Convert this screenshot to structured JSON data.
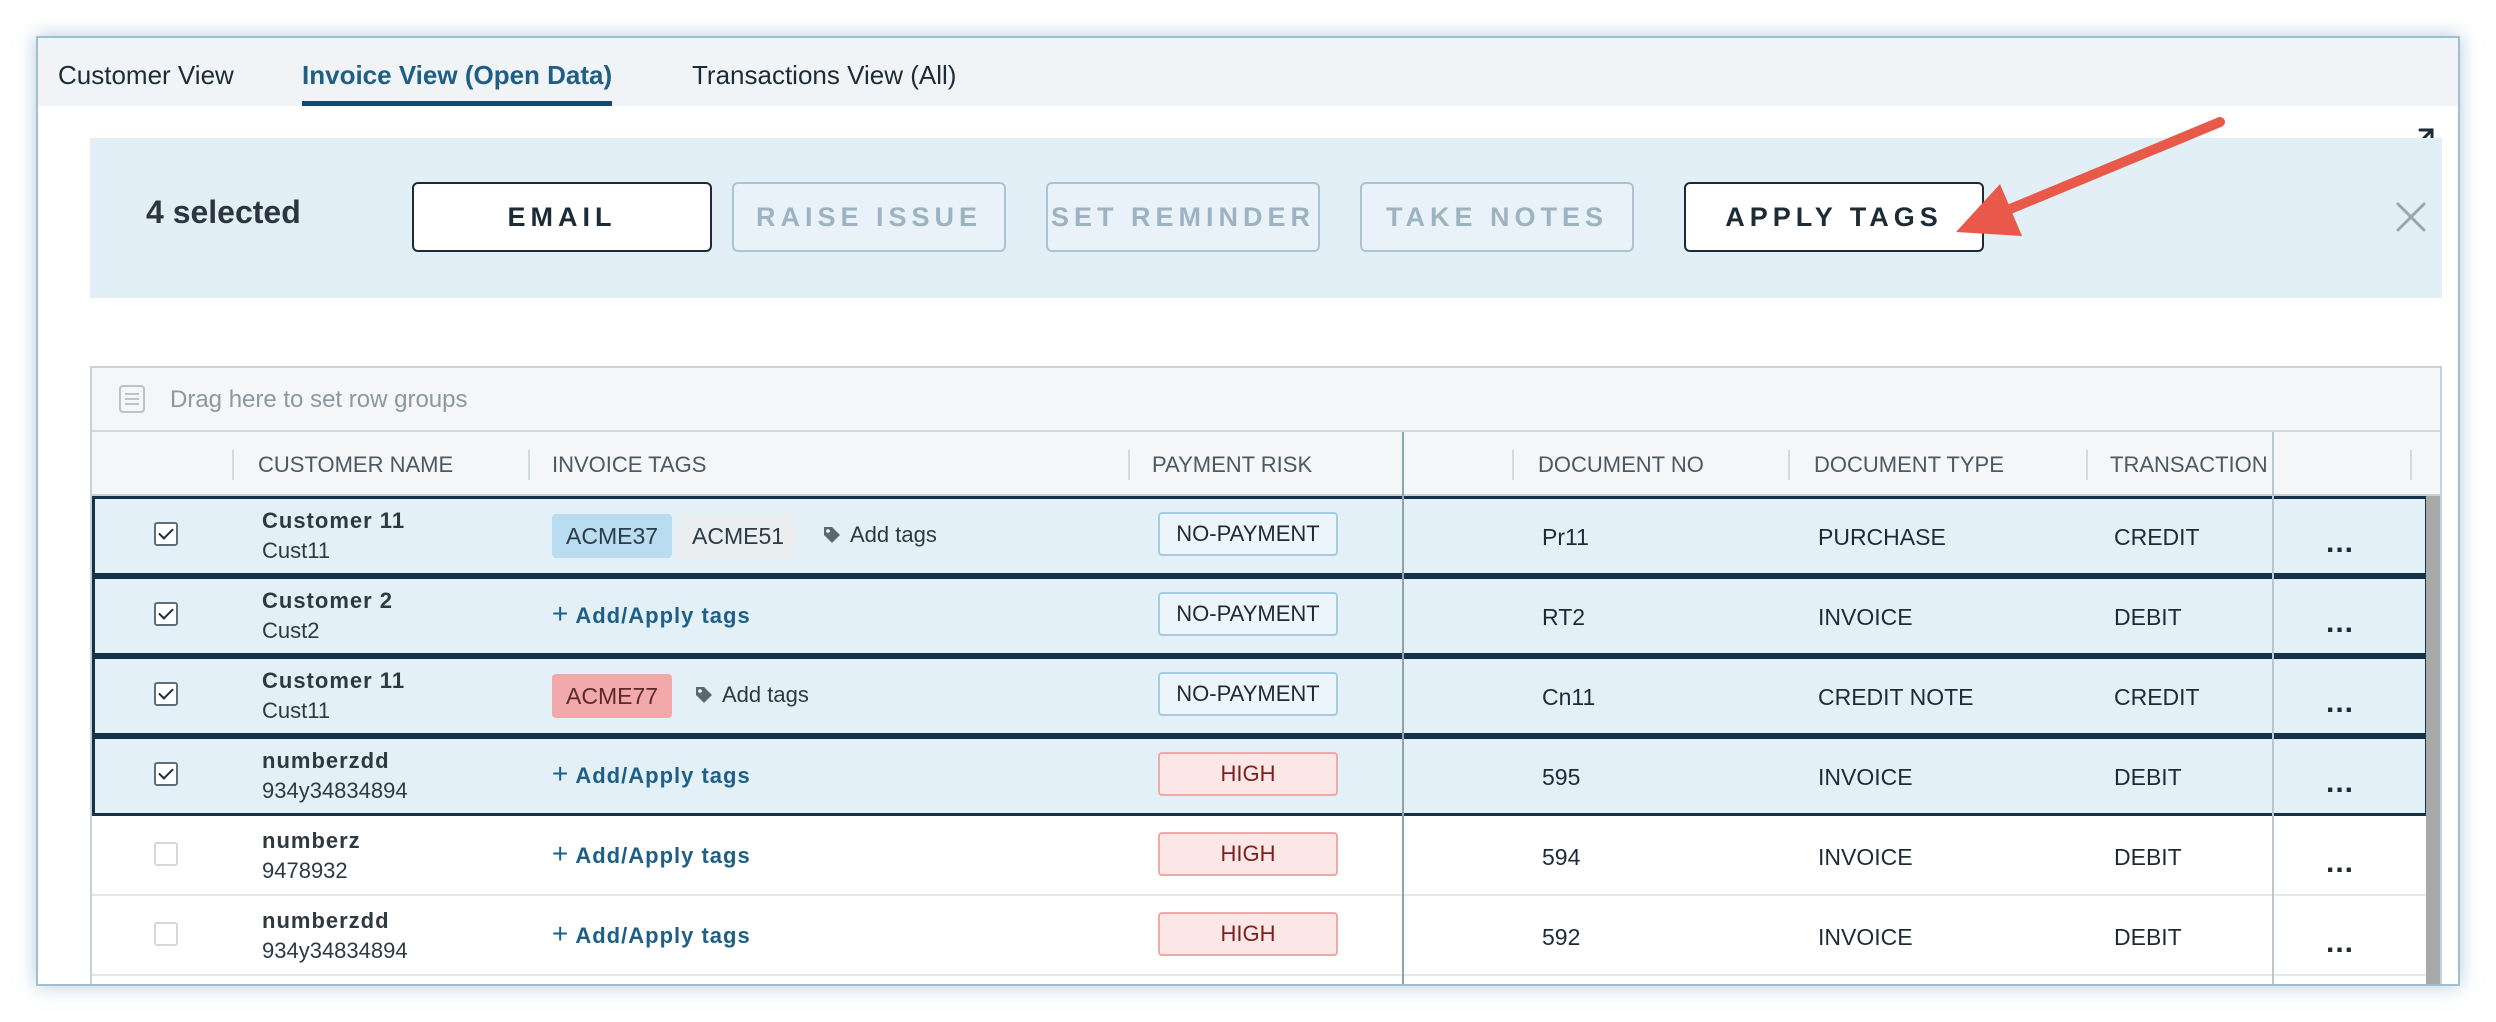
{
  "tabs": [
    "Customer View",
    "Invoice View (Open Data)",
    "Transactions View (All)"
  ],
  "selection": {
    "count_label": "4 selected",
    "buttons": {
      "email": "EMAIL",
      "raise_issue": "RAISE ISSUE",
      "set_reminder": "SET REMINDER",
      "take_notes": "TAKE NOTES",
      "apply_tags": "APPLY TAGS"
    }
  },
  "grid": {
    "group_placeholder": "Drag here to set row groups",
    "columns": {
      "customer_name": "CUSTOMER NAME",
      "invoice_tags": "INVOICE TAGS",
      "payment_risk": "PAYMENT RISK",
      "document_no": "DOCUMENT NO",
      "document_type": "DOCUMENT TYPE",
      "transaction": "TRANSACTION"
    },
    "add_tags_label": "Add tags",
    "add_apply_label": "Add/Apply tags",
    "more_label": "...",
    "rows": [
      {
        "name": "Customer 11",
        "id": "Cust11",
        "tags": [
          "ACME37",
          "ACME51"
        ],
        "risk": "NO-PAYMENT",
        "doc_no": "Pr11",
        "doc_type": "PURCHASE",
        "transaction": "CREDIT",
        "selected": true
      },
      {
        "name": "Customer 2",
        "id": "Cust2",
        "tags": [],
        "risk": "NO-PAYMENT",
        "doc_no": "RT2",
        "doc_type": "INVOICE",
        "transaction": "DEBIT",
        "selected": true
      },
      {
        "name": "Customer 11",
        "id": "Cust11",
        "tags": [
          "ACME77"
        ],
        "risk": "NO-PAYMENT",
        "doc_no": "Cn11",
        "doc_type": "CREDIT NOTE",
        "transaction": "CREDIT",
        "selected": true
      },
      {
        "name": "numberzdd",
        "id": "934y34834894",
        "tags": [],
        "risk": "HIGH",
        "doc_no": "595",
        "doc_type": "INVOICE",
        "transaction": "DEBIT",
        "selected": true
      },
      {
        "name": "numberz",
        "id": "9478932",
        "tags": [],
        "risk": "HIGH",
        "doc_no": "594",
        "doc_type": "INVOICE",
        "transaction": "DEBIT",
        "selected": false
      },
      {
        "name": "numberzdd",
        "id": "934y34834894",
        "tags": [],
        "risk": "HIGH",
        "doc_no": "592",
        "doc_type": "INVOICE",
        "transaction": "DEBIT",
        "selected": false
      }
    ]
  },
  "colors": {
    "accent": "#1f5f86",
    "selection_bg": "#e3eff7",
    "annotation_arrow": "#e9594a"
  }
}
